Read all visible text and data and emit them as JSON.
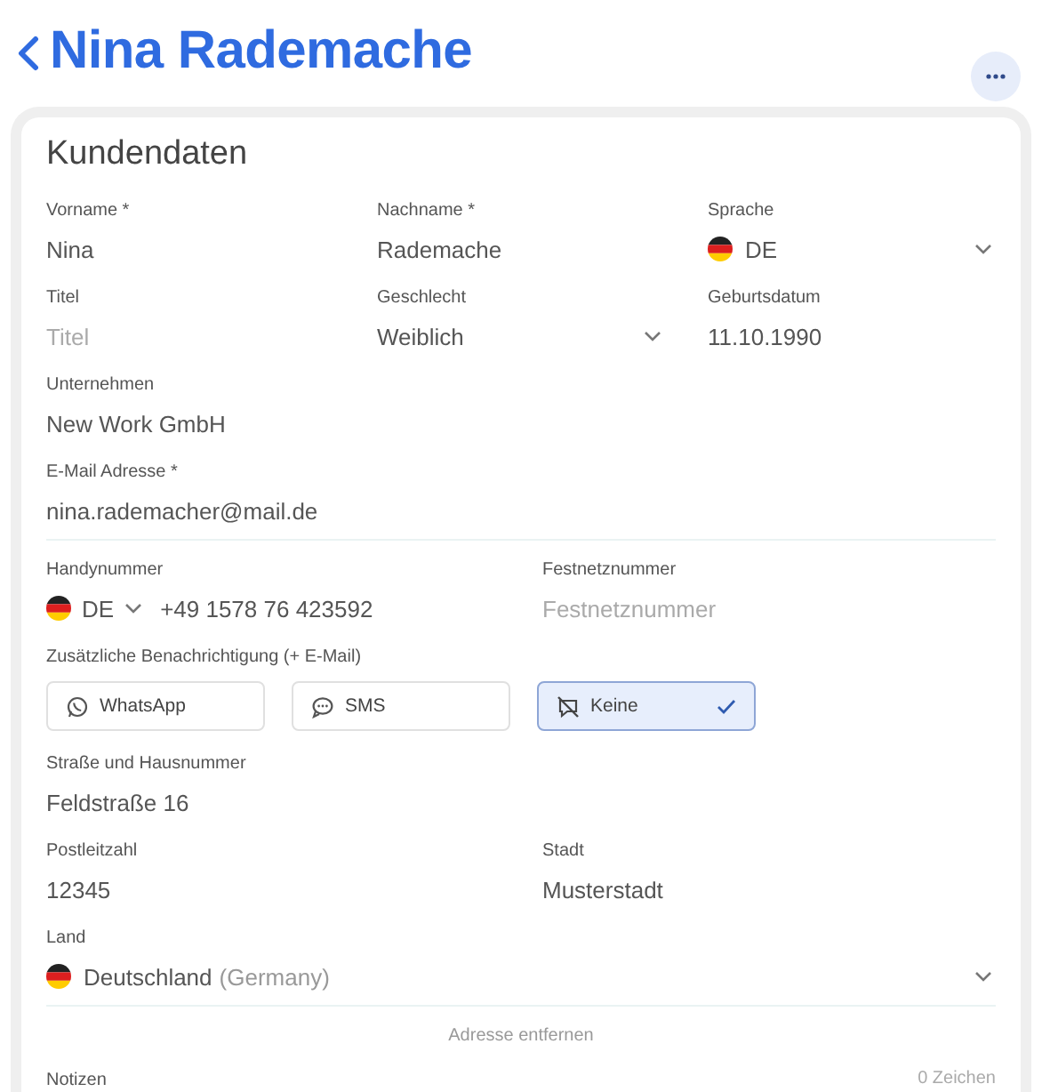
{
  "header": {
    "title": "Nina Rademache"
  },
  "card": {
    "title": "Kundendaten",
    "rows": [
      {
        "fields": [
          {
            "label": "Vorname *",
            "kind": "text",
            "value": "Nina"
          },
          {
            "label": "Nachname *",
            "kind": "text",
            "value": "Rademache"
          },
          {
            "label": "Sprache",
            "kind": "flag-select",
            "value": "DE"
          }
        ]
      },
      {
        "fields": [
          {
            "label": "Titel",
            "kind": "text",
            "placeholder": "Titel"
          },
          {
            "label": "Geschlecht",
            "kind": "select",
            "value": "Weiblich"
          },
          {
            "label": "Geburtsdatum",
            "kind": "text",
            "value": "11.10.1990"
          }
        ]
      },
      {
        "fields": [
          {
            "label": "Unternehmen",
            "kind": "text",
            "value": "New Work GmbH"
          }
        ]
      },
      {
        "fields": [
          {
            "label": "E-Mail Adresse *",
            "kind": "text",
            "value": "nina.rademacher@mail.de"
          }
        ]
      },
      {
        "fields": [
          {
            "label": "Handynummer",
            "kind": "phone",
            "country": "DE",
            "value": "+49 1578 76 423592"
          },
          {
            "label": "Festnetznummer",
            "kind": "text",
            "placeholder": "Festnetznummer"
          }
        ]
      }
    ],
    "notification": {
      "label": "Zusätzliche Benachrichtigung (+ E-Mail)",
      "options": [
        {
          "label": "WhatsApp",
          "selected": false
        },
        {
          "label": "SMS",
          "selected": false
        },
        {
          "label": "Keine",
          "selected": true
        }
      ]
    },
    "address_rows": [
      {
        "fields": [
          {
            "label": "Straße und Hausnummer",
            "kind": "text",
            "value": "Feldstraße 16"
          }
        ]
      },
      {
        "fields": [
          {
            "label": "Postleitzahl",
            "kind": "text",
            "value": "12345"
          },
          {
            "label": "Stadt",
            "kind": "text",
            "value": "Musterstadt"
          }
        ]
      },
      {
        "fields": [
          {
            "label": "Land",
            "kind": "flag-select",
            "value": "Deutschland",
            "hint": "(Germany)"
          }
        ]
      }
    ],
    "remove_address": "Adresse entfernen",
    "notes": {
      "label": "Notizen",
      "counter": "0 Zeichen"
    }
  }
}
